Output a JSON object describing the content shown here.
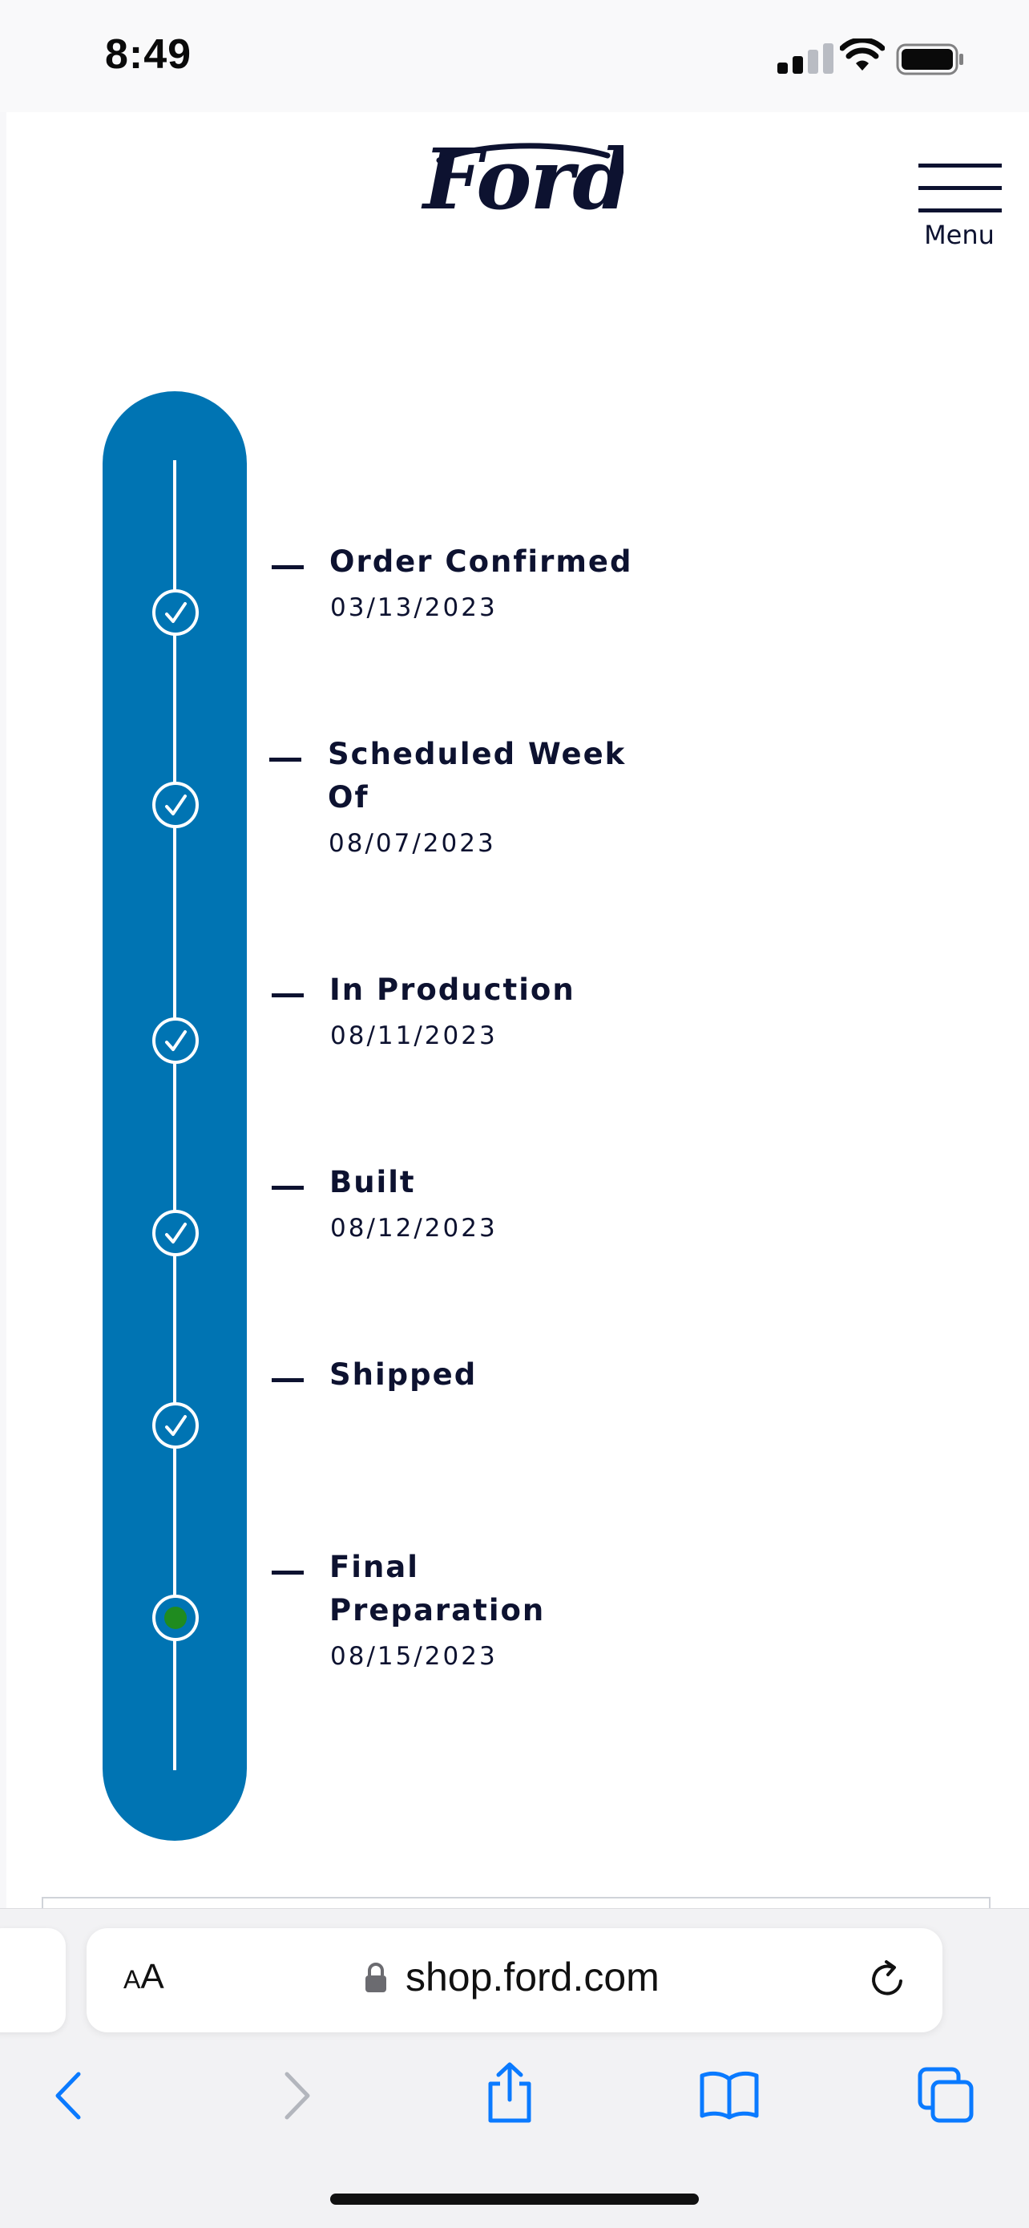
{
  "status_bar": {
    "time": "8:49"
  },
  "header": {
    "logo_text": "Ford",
    "menu_label": "Menu"
  },
  "order_tracker": {
    "steps": [
      {
        "label_line1": "Order Confirmed",
        "label_line2": "",
        "date": "03/13/2023",
        "status": "complete"
      },
      {
        "label_line1": "Scheduled Week",
        "label_line2": "Of",
        "date": "08/07/2023",
        "status": "complete"
      },
      {
        "label_line1": "In Production",
        "label_line2": "",
        "date": "08/11/2023",
        "status": "complete"
      },
      {
        "label_line1": "Built",
        "label_line2": "",
        "date": "08/12/2023",
        "status": "complete"
      },
      {
        "label_line1": "Shipped",
        "label_line2": "",
        "date": "",
        "status": "complete"
      },
      {
        "label_line1": "Final",
        "label_line2": "Preparation",
        "date": "08/15/2023",
        "status": "current"
      }
    ],
    "colors": {
      "track": "#0074b3",
      "current_dot": "#1f8b1f",
      "text": "#0d1230"
    }
  },
  "browser": {
    "text_size_button": {
      "small": "A",
      "large": "A"
    },
    "url": "shop.ford.com",
    "icons": [
      "back-icon",
      "forward-icon",
      "share-icon",
      "bookmarks-icon",
      "tabs-icon",
      "reload-icon",
      "lock-icon"
    ]
  }
}
